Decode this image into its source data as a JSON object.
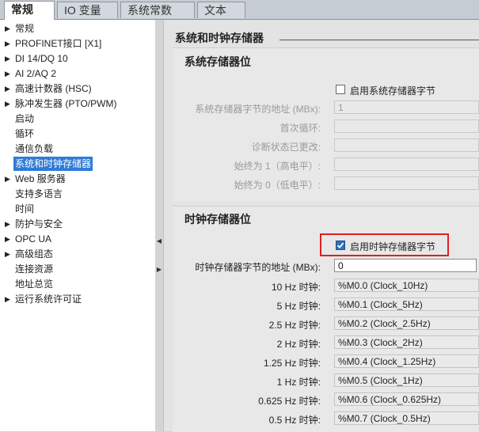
{
  "tabs": [
    {
      "label": "常规",
      "active": true
    },
    {
      "label": "IO 变量",
      "active": false
    },
    {
      "label": "系统常数",
      "active": false
    },
    {
      "label": "文本",
      "active": false
    }
  ],
  "tree": [
    {
      "label": "常规",
      "expandable": true,
      "selected": false
    },
    {
      "label": "PROFINET接口 [X1]",
      "expandable": true,
      "selected": false
    },
    {
      "label": "DI 14/DQ 10",
      "expandable": true,
      "selected": false
    },
    {
      "label": "AI 2/AQ 2",
      "expandable": true,
      "selected": false
    },
    {
      "label": "高速计数器 (HSC)",
      "expandable": true,
      "selected": false
    },
    {
      "label": "脉冲发生器 (PTO/PWM)",
      "expandable": true,
      "selected": false
    },
    {
      "label": "启动",
      "expandable": false,
      "selected": false
    },
    {
      "label": "循环",
      "expandable": false,
      "selected": false
    },
    {
      "label": "通信负载",
      "expandable": false,
      "selected": false
    },
    {
      "label": "系统和时钟存储器",
      "expandable": false,
      "selected": true
    },
    {
      "label": "Web 服务器",
      "expandable": true,
      "selected": false
    },
    {
      "label": "支持多语言",
      "expandable": false,
      "selected": false
    },
    {
      "label": "时间",
      "expandable": false,
      "selected": false
    },
    {
      "label": "防护与安全",
      "expandable": true,
      "selected": false
    },
    {
      "label": "OPC UA",
      "expandable": true,
      "selected": false
    },
    {
      "label": "高级组态",
      "expandable": true,
      "selected": false
    },
    {
      "label": "连接资源",
      "expandable": false,
      "selected": false
    },
    {
      "label": "地址总览",
      "expandable": false,
      "selected": false
    },
    {
      "label": "运行系统许可证",
      "expandable": true,
      "selected": false
    }
  ],
  "main_title": "系统和时钟存储器",
  "system_section": {
    "title": "系统存储器位",
    "enable_label": "启用系统存储器字节",
    "enable_checked": false,
    "rows": [
      {
        "label": "系统存储器字节的地址 (MBx):",
        "value": "1"
      },
      {
        "label": "首次循环:",
        "value": ""
      },
      {
        "label": "诊断状态已更改:",
        "value": ""
      },
      {
        "label": "始终为 1（高电平）:",
        "value": ""
      },
      {
        "label": "始终为 0（低电平）:",
        "value": ""
      }
    ]
  },
  "clock_section": {
    "title": "时钟存储器位",
    "enable_label": "启用时钟存储器字节",
    "enable_checked": true,
    "address_label": "时钟存储器字节的地址 (MBx):",
    "address_value": "0",
    "rows": [
      {
        "label": "10 Hz 时钟:",
        "value": "%M0.0 (Clock_10Hz)"
      },
      {
        "label": "5 Hz 时钟:",
        "value": "%M0.1 (Clock_5Hz)"
      },
      {
        "label": "2.5 Hz 时钟:",
        "value": "%M0.2 (Clock_2.5Hz)"
      },
      {
        "label": "2 Hz 时钟:",
        "value": "%M0.3 (Clock_2Hz)"
      },
      {
        "label": "1.25 Hz 时钟:",
        "value": "%M0.4 (Clock_1.25Hz)"
      },
      {
        "label": "1 Hz 时钟:",
        "value": "%M0.5 (Clock_1Hz)"
      },
      {
        "label": "0.625 Hz 时钟:",
        "value": "%M0.6 (Clock_0.625Hz)"
      },
      {
        "label": "0.5 Hz 时钟:",
        "value": "%M0.7 (Clock_0.5Hz)"
      }
    ]
  },
  "colors": {
    "selection": "#2f7bd6",
    "highlight_box": "#e02020",
    "checkbox_checked": "#2e6fc0"
  }
}
